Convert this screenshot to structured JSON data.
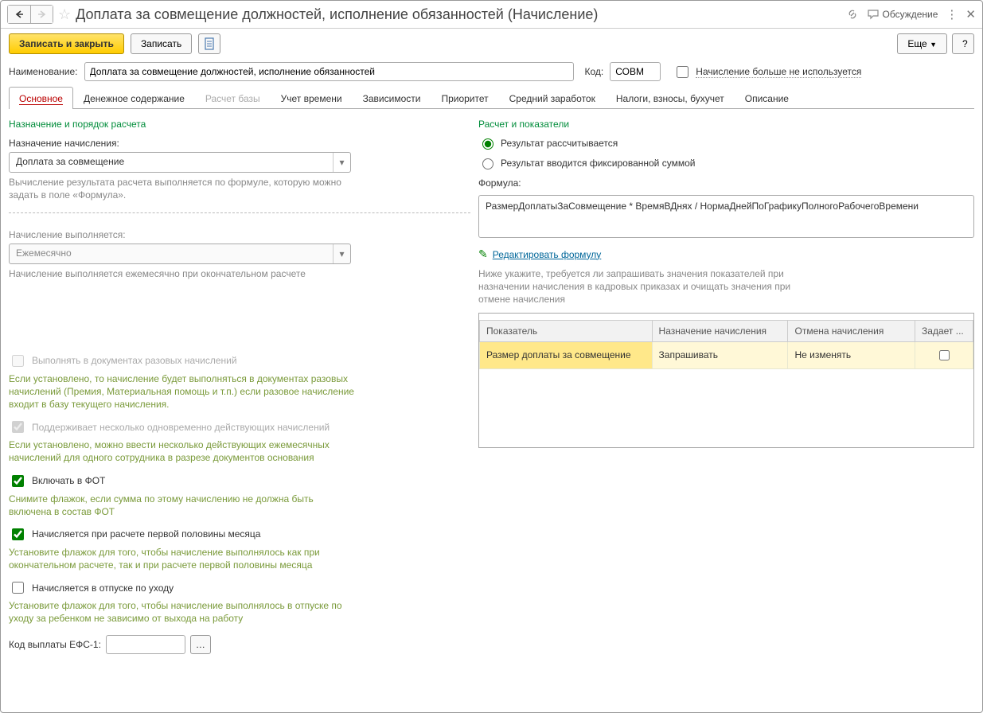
{
  "titlebar": {
    "title": "Доплата за совмещение должностей, исполнение обязанностей (Начисление)",
    "discussion_label": "Обсуждение"
  },
  "toolbar": {
    "save_close": "Записать и закрыть",
    "save": "Записать",
    "more": "Еще",
    "help": "?"
  },
  "header": {
    "name_label": "Наименование:",
    "name_value": "Доплата за совмещение должностей, исполнение обязанностей",
    "code_label": "Код:",
    "code_value": "СОВМ",
    "obsolete_label": "Начисление больше не используется"
  },
  "tabs": {
    "main": "Основное",
    "money": "Денежное содержание",
    "base": "Расчет базы",
    "time": "Учет времени",
    "deps": "Зависимости",
    "priority": "Приоритет",
    "avg": "Средний заработок",
    "taxes": "Налоги, взносы, бухучет",
    "desc": "Описание"
  },
  "left": {
    "section1_title": "Назначение и порядок расчета",
    "purpose_label": "Назначение начисления:",
    "purpose_value": "Доплата за совмещение",
    "purpose_hint": "Вычисление результата расчета выполняется по формуле, которую можно задать в поле «Формула».",
    "performed_label": "Начисление выполняется:",
    "performed_value": "Ежемесячно",
    "performed_hint": "Начисление выполняется ежемесячно при окончательном расчете",
    "chk1_label": "Выполнять в документах разовых начислений",
    "chk1_hint": "Если установлено, то начисление будет выполняться в документах разовых начислений (Премия, Материальная помощь и т.п.) если разовое начисление входит в базу текущего начисления.",
    "chk2_label": "Поддерживает несколько одновременно действующих начислений",
    "chk2_hint": "Если установлено, можно ввести несколько действующих ежемесячных начислений для одного сотрудника в разрезе документов основания",
    "chk3_label": "Включать в ФОТ",
    "chk3_hint": "Снимите флажок, если сумма по этому начислению не должна быть включена в состав ФОТ",
    "chk4_label": "Начисляется при расчете первой половины месяца",
    "chk4_hint": "Установите флажок для того, чтобы начисление выполнялось как при окончательном расчете, так и при расчете первой половины месяца",
    "chk5_label": "Начисляется в отпуске по уходу",
    "chk5_hint": "Установите флажок для того, чтобы начисление выполнялось в отпуске по уходу за ребенком не зависимо от выхода на работу",
    "efs_label": "Код выплаты ЕФС-1:",
    "efs_value": ""
  },
  "right": {
    "section_title": "Расчет и показатели",
    "radio1": "Результат рассчитывается",
    "radio2": "Результат вводится фиксированной суммой",
    "formula_label": "Формула:",
    "formula_value": "РазмерДоплатыЗаСовмещение * ВремяВДнях / НормаДнейПоГрафикуПолногоРабочегоВремени",
    "edit_link": "Редактировать формулу",
    "table_hint": "Ниже укажите, требуется ли запрашивать значения показателей при назначении начисления в кадровых приказах и очищать значения при отмене начисления",
    "table": {
      "col1": "Показатель",
      "col2": "Назначение начисления",
      "col3": "Отмена начисления",
      "col4": "Задает ...",
      "row1": {
        "c1": "Размер доплаты за совмещение",
        "c2": "Запрашивать",
        "c3": "Не изменять"
      }
    }
  }
}
